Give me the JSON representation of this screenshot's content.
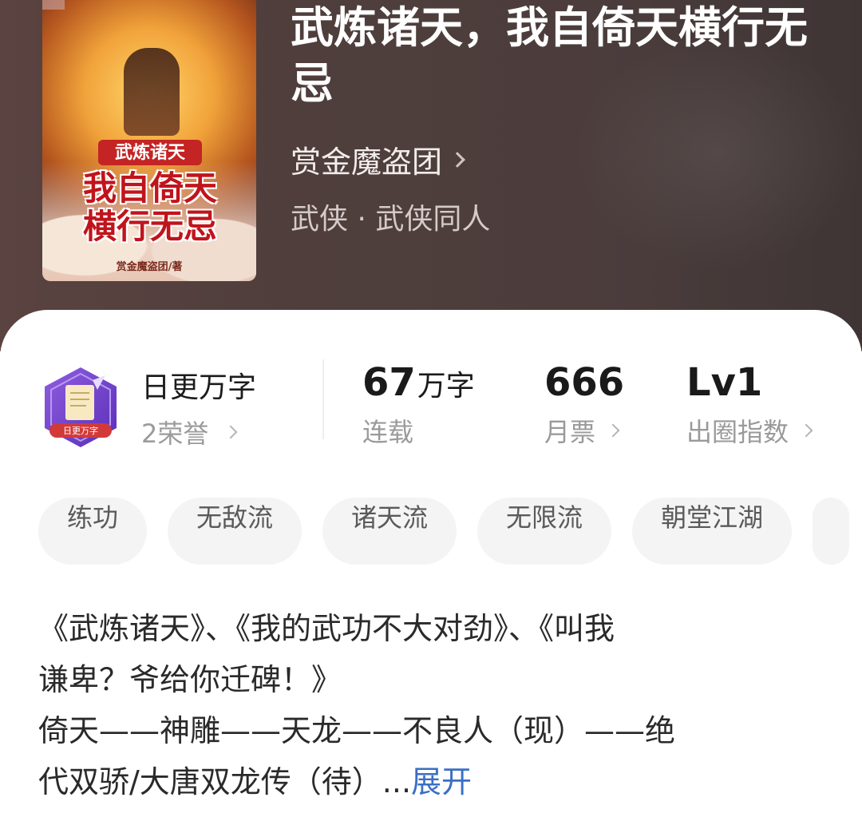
{
  "book": {
    "title": "武炼诸天，我自倚天横行无忌",
    "author": "赏金魔盗团",
    "genre": "武侠 · 武侠同人",
    "cover": {
      "small_text": "武炼诸天",
      "big_text_line1": "我自倚天",
      "big_text_line2": "横行无忌",
      "author_text": "赏金魔盗团/著"
    }
  },
  "honor": {
    "badge_text": "日更万字",
    "title": "日更万字",
    "subtitle": "2荣誉"
  },
  "stats": [
    {
      "value": "67",
      "unit": "万字",
      "label": "连载"
    },
    {
      "value": "666",
      "unit": "",
      "label": "月票"
    },
    {
      "value": "Lv1",
      "unit": "",
      "label": "出圈指数"
    }
  ],
  "tags": [
    "练功",
    "无敌流",
    "诸天流",
    "无限流",
    "朝堂江湖"
  ],
  "description": {
    "line1": "《武炼诸天》、《我的武功不大对劲》、《叫我",
    "line2": "谦卑？爷给你迁碑！》",
    "line3": "倚天——神雕——天龙——不良人（现）——绝",
    "line4": "代双骄/大唐双龙传（待）...",
    "expand_label": "展开"
  }
}
